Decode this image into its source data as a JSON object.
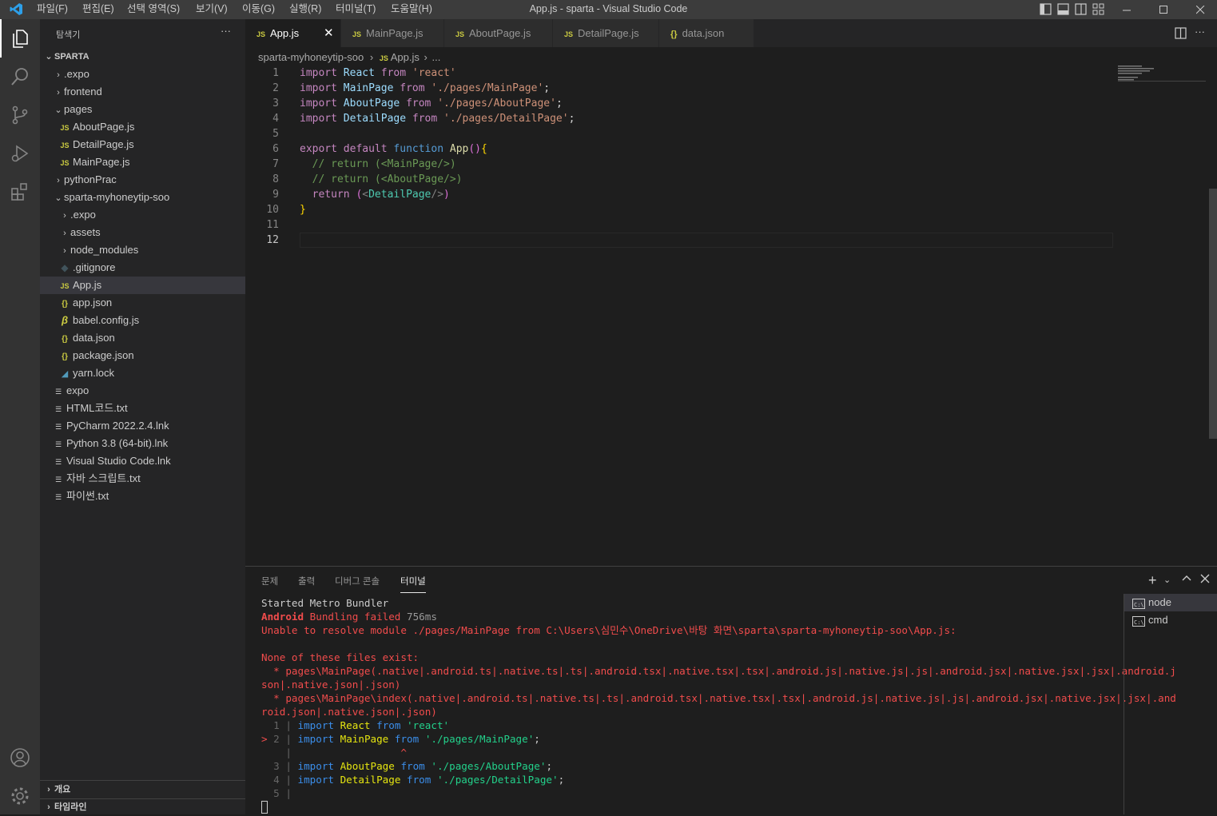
{
  "menu": [
    "파일(F)",
    "편집(E)",
    "선택 영역(S)",
    "보기(V)",
    "이동(G)",
    "실행(R)",
    "터미널(T)",
    "도움말(H)"
  ],
  "window_title": "App.js - sparta - Visual Studio Code",
  "sidebar": {
    "title": "탐색기",
    "more": "···",
    "root": "SPARTA",
    "items": [
      {
        "label": ".expo",
        "kind": "folder",
        "open": false
      },
      {
        "label": "frontend",
        "kind": "folder",
        "open": false
      },
      {
        "label": "pages",
        "kind": "folder",
        "open": true
      },
      {
        "label": "AboutPage.js",
        "kind": "js"
      },
      {
        "label": "DetailPage.js",
        "kind": "js"
      },
      {
        "label": "MainPage.js",
        "kind": "js"
      },
      {
        "label": "pythonPrac",
        "kind": "folder",
        "open": false
      },
      {
        "label": "sparta-myhoneytip-soo",
        "kind": "folder",
        "open": true
      },
      {
        "label": ".expo",
        "kind": "folder",
        "open": false
      },
      {
        "label": "assets",
        "kind": "folder",
        "open": false
      },
      {
        "label": "node_modules",
        "kind": "folder",
        "open": false
      },
      {
        "label": ".gitignore",
        "kind": "git"
      },
      {
        "label": "App.js",
        "kind": "js",
        "selected": true
      },
      {
        "label": "app.json",
        "kind": "json"
      },
      {
        "label": "babel.config.js",
        "kind": "babel"
      },
      {
        "label": "data.json",
        "kind": "json"
      },
      {
        "label": "package.json",
        "kind": "json"
      },
      {
        "label": "yarn.lock",
        "kind": "yarn"
      },
      {
        "label": "expo",
        "kind": "txt"
      },
      {
        "label": "HTML코드.txt",
        "kind": "txt"
      },
      {
        "label": "PyCharm 2022.2.4.lnk",
        "kind": "txt"
      },
      {
        "label": "Python 3.8 (64-bit).lnk",
        "kind": "txt"
      },
      {
        "label": "Visual Studio Code.lnk",
        "kind": "txt"
      },
      {
        "label": "자바 스크립트.txt",
        "kind": "txt"
      },
      {
        "label": "파이썬.txt",
        "kind": "txt"
      }
    ],
    "outline": "개요",
    "timeline": "타임라인"
  },
  "tabs": [
    {
      "label": "App.js",
      "icon": "JS",
      "active": true
    },
    {
      "label": "MainPage.js",
      "icon": "JS"
    },
    {
      "label": "AboutPage.js",
      "icon": "JS"
    },
    {
      "label": "DetailPage.js",
      "icon": "JS"
    },
    {
      "label": "data.json",
      "icon": "{}"
    }
  ],
  "breadcrumb": {
    "folder": "sparta-myhoneytip-soo",
    "file": "App.js",
    "more": "..."
  },
  "editor": {
    "line_numbers": [
      "1",
      "2",
      "3",
      "4",
      "5",
      "6",
      "7",
      "8",
      "9",
      "10",
      "11",
      "12"
    ],
    "current_line": "12",
    "lines": [
      "import React from 'react'",
      "import MainPage from './pages/MainPage';",
      "import AboutPage from './pages/AboutPage';",
      "import DetailPage from './pages/DetailPage';",
      "",
      "export default function App(){",
      "  // return (<MainPage/>)",
      "  // return (<AboutPage/>)",
      "  return (<DetailPage/>)",
      "}",
      "",
      ""
    ]
  },
  "panel": {
    "tabs": [
      "문제",
      "출력",
      "디버그 콘솔",
      "터미널"
    ],
    "active_tab": "터미널",
    "terminal": {
      "started": "Started Metro Bundler",
      "android": "Android",
      "bundling_failed": " Bundling failed",
      "time": " 756ms",
      "unable": "Unable to resolve module ./pages/MainPage from C:\\Users\\심민수\\OneDrive\\바탕 화면\\sparta\\sparta-myhoneytip-soo\\App.js:",
      "none_exist": "None of these files exist:",
      "list1a": "  * pages\\MainPage(.native|.android.ts|.native.ts|.ts|.android.tsx|.native.tsx|.tsx|.android.js|.native.js|.js|.android.jsx|.native.jsx|.jsx|.android.j",
      "list1b": "son|.native.json|.json)",
      "list2a": "  * pages\\MainPage\\index(.native|.android.ts|.native.ts|.ts|.android.tsx|.native.tsx|.tsx|.android.js|.native.js|.js|.android.jsx|.native.jsx|.jsx|.and",
      "list2b": "roid.json|.native.json|.json)",
      "caret": "^",
      "marker": ">"
    },
    "instances": [
      "node",
      "cmd"
    ]
  }
}
